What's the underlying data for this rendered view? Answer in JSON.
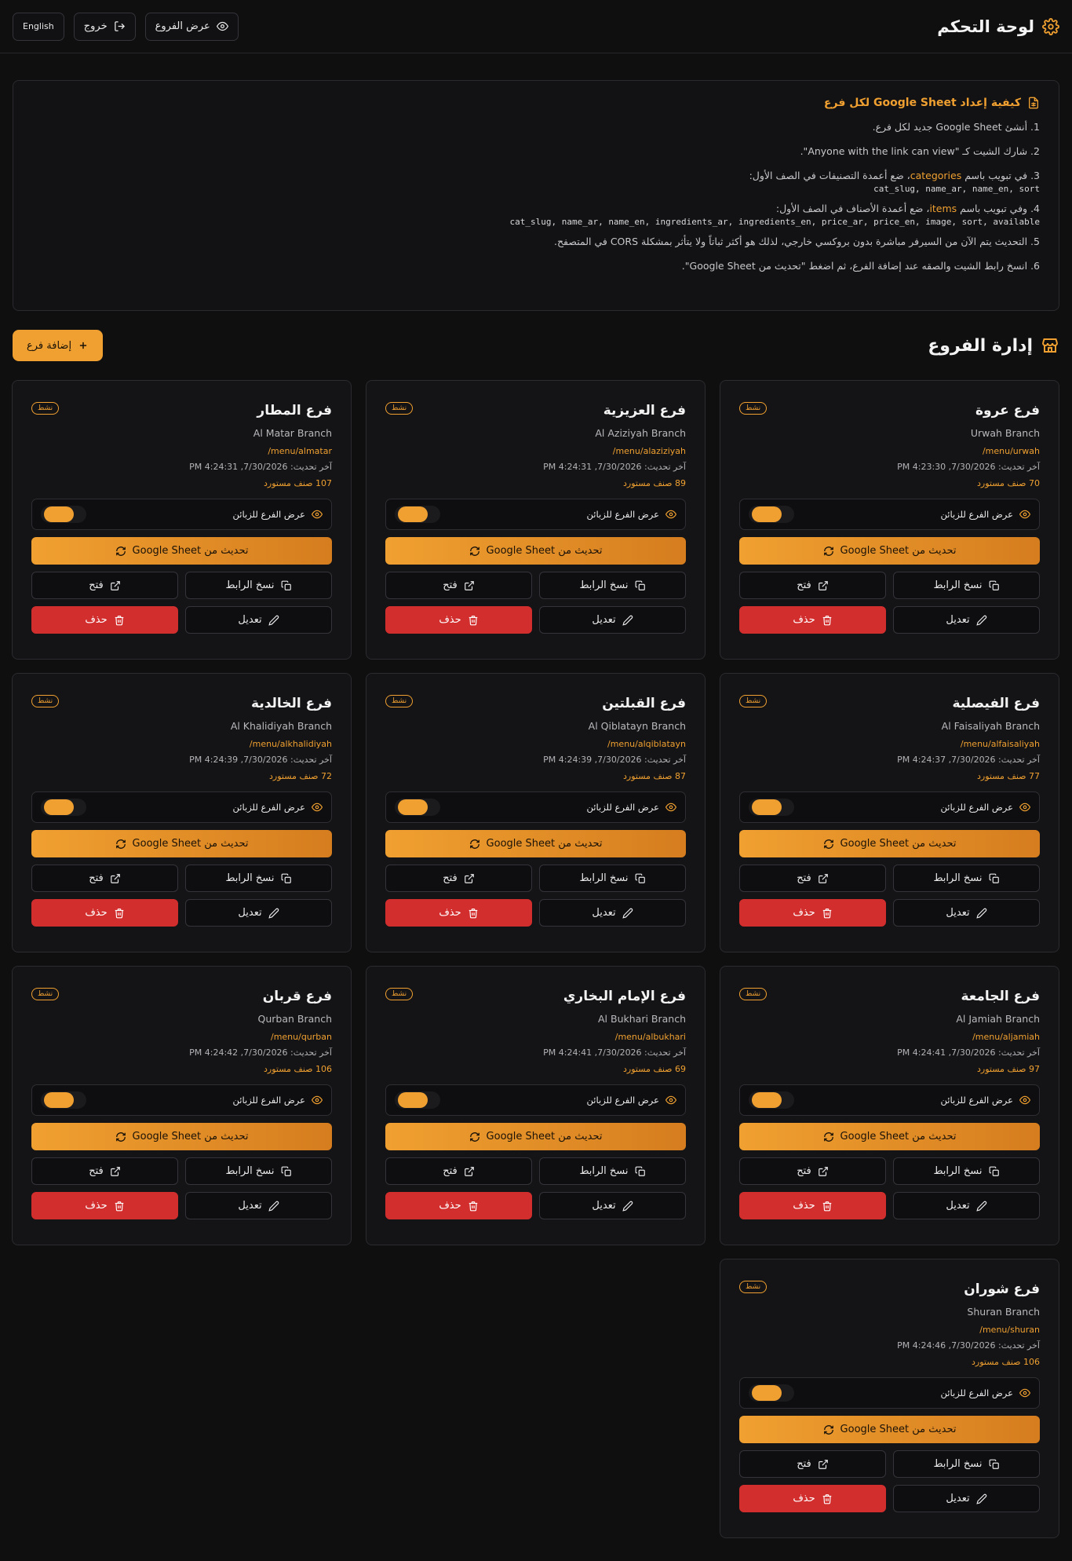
{
  "header": {
    "title": "لوحة التحكم",
    "show_branches_label": "عرض الفروع",
    "logout_label": "خروج",
    "language_label": "English"
  },
  "info": {
    "title": "كيفية إعداد Google Sheet لكل فرع",
    "steps": [
      "1. أنشئ Google Sheet جديد لكل فرع.",
      "2. شارك الشيت كـ \"Anyone with the link can view\".",
      "3. في تبويب باسم ",
      "4. وفي تبويب باسم ",
      "5. التحديث يتم الآن من السيرفر مباشرة بدون بروكسي خارجي، لذلك هو أكثر ثباتاً ولا يتأثر بمشكلة CORS في المتصفح.",
      "6. انسخ رابط الشيت والصقه عند إضافة الفرع، ثم اضغط \"تحديث من Google Sheet\"."
    ],
    "step3_keyword": "categories",
    "step3_rest": "، ضع أعمدة التصنيفات في الصف الأول:",
    "step3_code": "cat_slug, name_ar, name_en, sort",
    "step4_keyword": "items",
    "step4_rest": "، ضع أعمدة الأصناف في الصف الأول:",
    "step4_code": "cat_slug, name_ar, name_en, ingredients_ar, ingredients_en, price_ar, price_en, image, sort, available"
  },
  "section": {
    "title": "إدارة الفروع",
    "add_label": "إضافة فرع"
  },
  "card_labels": {
    "badge": "نشط",
    "visible": "عرض الفرع للزبائن",
    "refresh": "تحديث من Google Sheet",
    "copy": "نسخ الرابط",
    "open": "فتح",
    "edit": "تعديل",
    "delete": "حذف"
  },
  "branches": [
    {
      "name": "فرع عروة",
      "en": "Urwah Branch",
      "path": "/menu/urwah",
      "updated": "آخر تحديث: 7/30/2026, 4:23:30 PM",
      "count": "70 صنف مستورد"
    },
    {
      "name": "فرع العزيزية",
      "en": "Al Aziziyah Branch",
      "path": "/menu/alaziziyah",
      "updated": "آخر تحديث: 7/30/2026, 4:24:31 PM",
      "count": "89 صنف مستورد"
    },
    {
      "name": "فرع المطار",
      "en": "Al Matar Branch",
      "path": "/menu/almatar",
      "updated": "آخر تحديث: 7/30/2026, 4:24:31 PM",
      "count": "107 صنف مستورد"
    },
    {
      "name": "فرع الفيصلية",
      "en": "Al Faisaliyah Branch",
      "path": "/menu/alfaisaliyah",
      "updated": "آخر تحديث: 7/30/2026, 4:24:37 PM",
      "count": "77 صنف مستورد"
    },
    {
      "name": "فرع القبلتين",
      "en": "Al Qiblatayn Branch",
      "path": "/menu/alqiblatayn",
      "updated": "آخر تحديث: 7/30/2026, 4:24:39 PM",
      "count": "87 صنف مستورد"
    },
    {
      "name": "فرع الخالدية",
      "en": "Al Khalidiyah Branch",
      "path": "/menu/alkhalidiyah",
      "updated": "آخر تحديث: 7/30/2026, 4:24:39 PM",
      "count": "72 صنف مستورد"
    },
    {
      "name": "فرع الجامعة",
      "en": "Al Jamiah Branch",
      "path": "/menu/aljamiah",
      "updated": "آخر تحديث: 7/30/2026, 4:24:41 PM",
      "count": "97 صنف مستورد"
    },
    {
      "name": "فرع الإمام البخاري",
      "en": "Al Bukhari Branch",
      "path": "/menu/albukhari",
      "updated": "آخر تحديث: 7/30/2026, 4:24:41 PM",
      "count": "69 صنف مستورد"
    },
    {
      "name": "فرع قربان",
      "en": "Qurban Branch",
      "path": "/menu/qurban",
      "updated": "آخر تحديث: 7/30/2026, 4:24:42 PM",
      "count": "106 صنف مستورد"
    },
    {
      "name": "فرع شوران",
      "en": "Shuran Branch",
      "path": "/menu/shuran",
      "updated": "آخر تحديث: 7/30/2026, 4:24:46 PM",
      "count": "106 صنف مستورد"
    }
  ],
  "colors": {
    "accent": "#f0a030",
    "danger": "#d32e2e",
    "background": "#0f0f10",
    "card": "#141416"
  }
}
